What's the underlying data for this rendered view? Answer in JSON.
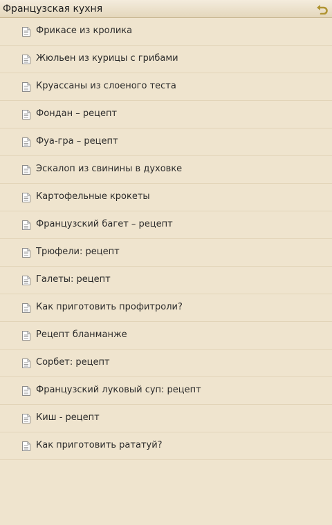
{
  "header": {
    "title": "Французская кухня",
    "back_icon": "undo-arrow-icon"
  },
  "colors": {
    "background": "#efe4ce",
    "header_bg": "#e8dcc3",
    "divider": "#e2d4b8",
    "back_arrow": "#b09432",
    "text": "#2b2b2b"
  },
  "list": {
    "item_icon": "document-icon",
    "items": [
      "Фрикасе из кролика",
      "Жюльен из курицы с грибами",
      "Круассаны из слоеного теста",
      "Фондан – рецепт",
      "Фуа-гра – рецепт",
      "Эскалоп из свинины в духовке",
      "Картофельные крокеты",
      "Французский багет – рецепт",
      "Трюфели: рецепт",
      "Галеты: рецепт",
      "Как приготовить профитроли?",
      "Рецепт бланманже",
      "Сорбет: рецепт",
      "Французский луковый суп: рецепт",
      "Киш - рецепт",
      "Как приготовить рататуй?"
    ]
  }
}
